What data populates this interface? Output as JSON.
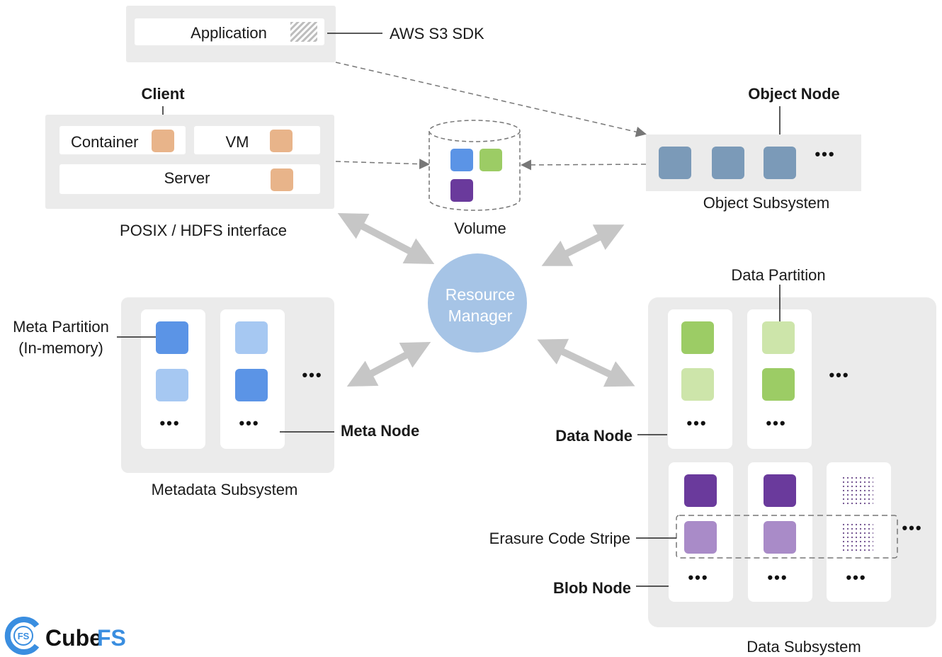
{
  "application": {
    "label": "Application",
    "sdk_label": "AWS S3 SDK"
  },
  "client": {
    "title": "Client",
    "items": [
      "Container",
      "VM",
      "Server"
    ],
    "interface_label": "POSIX / HDFS interface"
  },
  "volume": {
    "label": "Volume"
  },
  "object": {
    "node_label": "Object Node",
    "subsystem_label": "Object Subsystem",
    "more": "..."
  },
  "resource_manager": {
    "line1": "Resource",
    "line2": "Manager"
  },
  "metadata": {
    "partition_line1": "Meta Partition",
    "partition_line2": "(In-memory)",
    "node_label": "Meta Node",
    "subsystem_label": "Metadata Subsystem",
    "more": "..."
  },
  "data": {
    "partition_label": "Data Partition",
    "node_label": "Data Node",
    "erasure_label": "Erasure Code Stripe",
    "blob_label": "Blob Node",
    "subsystem_label": "Data Subsystem",
    "more": "..."
  },
  "logo": {
    "text_a": "Cube",
    "text_b": "FS",
    "badge": "FS"
  },
  "colors": {
    "panel": "#ebebeb",
    "orange": "#e8b48a",
    "blue": "#5b94e6",
    "light_blue": "#a6c8f2",
    "green": "#9ccc65",
    "light_green": "#cde5aa",
    "purple": "#6a3a9c",
    "light_purple": "#a98bc8",
    "object_node": "#7b9ab8",
    "resource_manager": "#a6c4e6",
    "arrow": "#c6c6c6",
    "brand": "#3a8ee0"
  }
}
